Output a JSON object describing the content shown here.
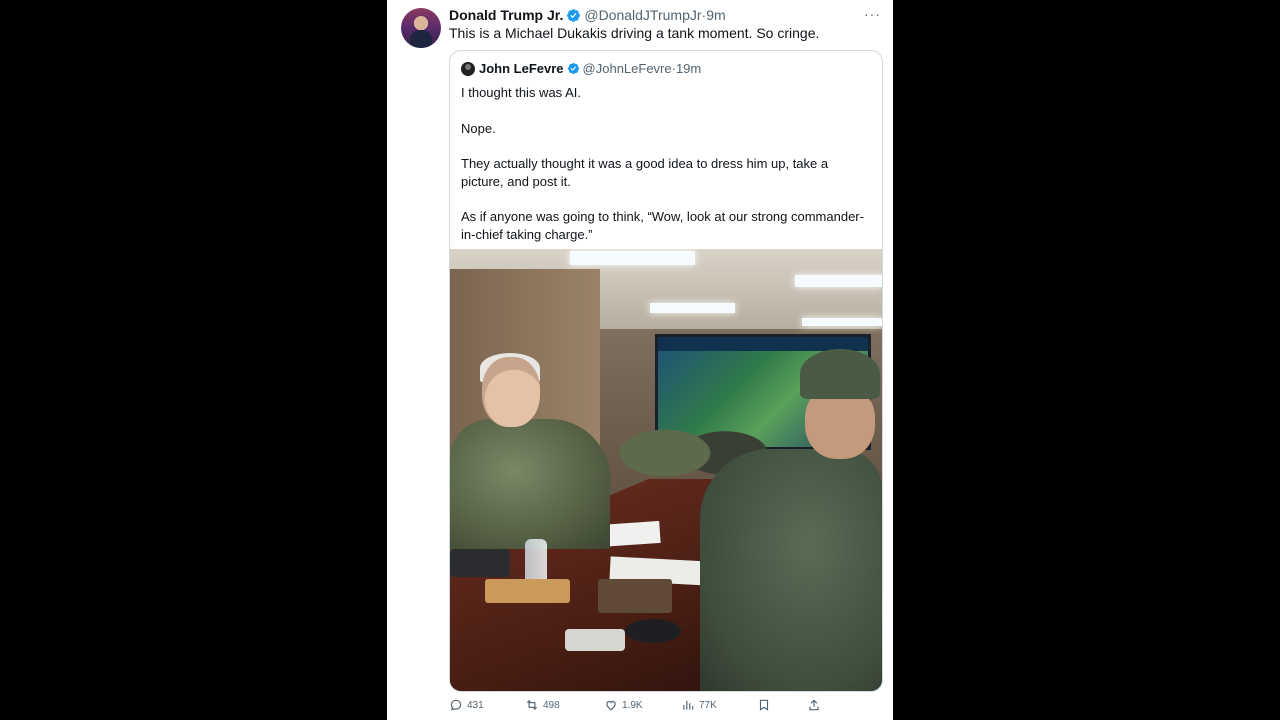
{
  "tweet": {
    "author_name": "Donald Trump Jr.",
    "author_handle": "@DonaldJTrumpJr",
    "separator": "·",
    "time": "9m",
    "more": "···",
    "text": "This is a Michael Dukakis driving a tank moment. So cringe."
  },
  "quoted_tweet": {
    "author_name": "John LeFevre",
    "author_handle": "@JohnLeFevre",
    "separator": "·",
    "time": "19m",
    "paragraphs": [
      "I thought this was AI.",
      "Nope.",
      "They actually thought it was a good idea to dress him up, take a picture, and post it.",
      "As if anyone was going to think, “Wow, look at our strong commander-in-chief taking charge.”"
    ]
  },
  "actions": {
    "replies": "431",
    "reposts": "498",
    "likes": "1.9K",
    "views": "77K"
  },
  "colors": {
    "background": "#000000",
    "card": "#ffffff",
    "verified": "#1d9bf0",
    "secondary_text": "#536471"
  },
  "icons": [
    "verified-badge-icon",
    "more-icon",
    "reply-icon",
    "repost-icon",
    "like-icon",
    "views-icon",
    "bookmark-icon",
    "share-icon"
  ]
}
